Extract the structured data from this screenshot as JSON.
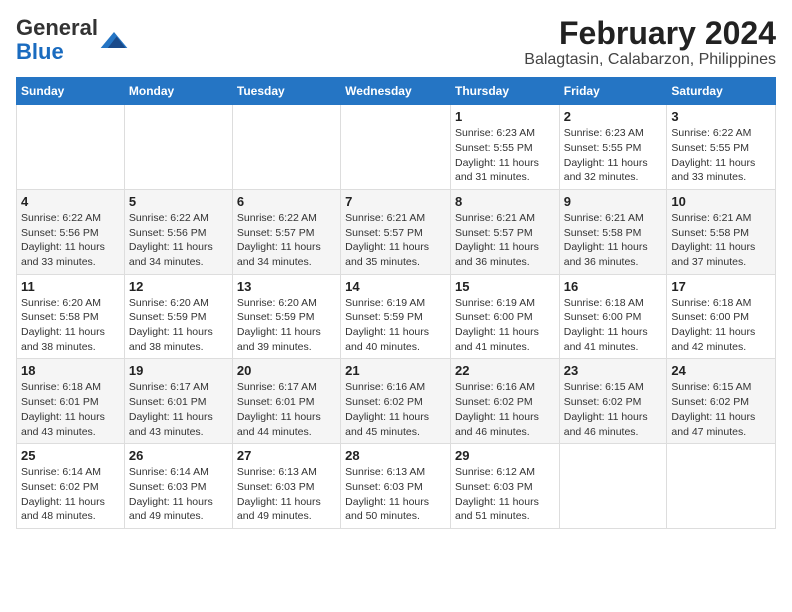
{
  "header": {
    "logo_general": "General",
    "logo_blue": "Blue",
    "title": "February 2024",
    "subtitle": "Balagtasin, Calabarzon, Philippines"
  },
  "weekdays": [
    "Sunday",
    "Monday",
    "Tuesday",
    "Wednesday",
    "Thursday",
    "Friday",
    "Saturday"
  ],
  "weeks": [
    [
      {
        "day": "",
        "info": ""
      },
      {
        "day": "",
        "info": ""
      },
      {
        "day": "",
        "info": ""
      },
      {
        "day": "",
        "info": ""
      },
      {
        "day": "1",
        "info": "Sunrise: 6:23 AM\nSunset: 5:55 PM\nDaylight: 11 hours and 31 minutes."
      },
      {
        "day": "2",
        "info": "Sunrise: 6:23 AM\nSunset: 5:55 PM\nDaylight: 11 hours and 32 minutes."
      },
      {
        "day": "3",
        "info": "Sunrise: 6:22 AM\nSunset: 5:55 PM\nDaylight: 11 hours and 33 minutes."
      }
    ],
    [
      {
        "day": "4",
        "info": "Sunrise: 6:22 AM\nSunset: 5:56 PM\nDaylight: 11 hours and 33 minutes."
      },
      {
        "day": "5",
        "info": "Sunrise: 6:22 AM\nSunset: 5:56 PM\nDaylight: 11 hours and 34 minutes."
      },
      {
        "day": "6",
        "info": "Sunrise: 6:22 AM\nSunset: 5:57 PM\nDaylight: 11 hours and 34 minutes."
      },
      {
        "day": "7",
        "info": "Sunrise: 6:21 AM\nSunset: 5:57 PM\nDaylight: 11 hours and 35 minutes."
      },
      {
        "day": "8",
        "info": "Sunrise: 6:21 AM\nSunset: 5:57 PM\nDaylight: 11 hours and 36 minutes."
      },
      {
        "day": "9",
        "info": "Sunrise: 6:21 AM\nSunset: 5:58 PM\nDaylight: 11 hours and 36 minutes."
      },
      {
        "day": "10",
        "info": "Sunrise: 6:21 AM\nSunset: 5:58 PM\nDaylight: 11 hours and 37 minutes."
      }
    ],
    [
      {
        "day": "11",
        "info": "Sunrise: 6:20 AM\nSunset: 5:58 PM\nDaylight: 11 hours and 38 minutes."
      },
      {
        "day": "12",
        "info": "Sunrise: 6:20 AM\nSunset: 5:59 PM\nDaylight: 11 hours and 38 minutes."
      },
      {
        "day": "13",
        "info": "Sunrise: 6:20 AM\nSunset: 5:59 PM\nDaylight: 11 hours and 39 minutes."
      },
      {
        "day": "14",
        "info": "Sunrise: 6:19 AM\nSunset: 5:59 PM\nDaylight: 11 hours and 40 minutes."
      },
      {
        "day": "15",
        "info": "Sunrise: 6:19 AM\nSunset: 6:00 PM\nDaylight: 11 hours and 41 minutes."
      },
      {
        "day": "16",
        "info": "Sunrise: 6:18 AM\nSunset: 6:00 PM\nDaylight: 11 hours and 41 minutes."
      },
      {
        "day": "17",
        "info": "Sunrise: 6:18 AM\nSunset: 6:00 PM\nDaylight: 11 hours and 42 minutes."
      }
    ],
    [
      {
        "day": "18",
        "info": "Sunrise: 6:18 AM\nSunset: 6:01 PM\nDaylight: 11 hours and 43 minutes."
      },
      {
        "day": "19",
        "info": "Sunrise: 6:17 AM\nSunset: 6:01 PM\nDaylight: 11 hours and 43 minutes."
      },
      {
        "day": "20",
        "info": "Sunrise: 6:17 AM\nSunset: 6:01 PM\nDaylight: 11 hours and 44 minutes."
      },
      {
        "day": "21",
        "info": "Sunrise: 6:16 AM\nSunset: 6:02 PM\nDaylight: 11 hours and 45 minutes."
      },
      {
        "day": "22",
        "info": "Sunrise: 6:16 AM\nSunset: 6:02 PM\nDaylight: 11 hours and 46 minutes."
      },
      {
        "day": "23",
        "info": "Sunrise: 6:15 AM\nSunset: 6:02 PM\nDaylight: 11 hours and 46 minutes."
      },
      {
        "day": "24",
        "info": "Sunrise: 6:15 AM\nSunset: 6:02 PM\nDaylight: 11 hours and 47 minutes."
      }
    ],
    [
      {
        "day": "25",
        "info": "Sunrise: 6:14 AM\nSunset: 6:02 PM\nDaylight: 11 hours and 48 minutes."
      },
      {
        "day": "26",
        "info": "Sunrise: 6:14 AM\nSunset: 6:03 PM\nDaylight: 11 hours and 49 minutes."
      },
      {
        "day": "27",
        "info": "Sunrise: 6:13 AM\nSunset: 6:03 PM\nDaylight: 11 hours and 49 minutes."
      },
      {
        "day": "28",
        "info": "Sunrise: 6:13 AM\nSunset: 6:03 PM\nDaylight: 11 hours and 50 minutes."
      },
      {
        "day": "29",
        "info": "Sunrise: 6:12 AM\nSunset: 6:03 PM\nDaylight: 11 hours and 51 minutes."
      },
      {
        "day": "",
        "info": ""
      },
      {
        "day": "",
        "info": ""
      }
    ]
  ]
}
